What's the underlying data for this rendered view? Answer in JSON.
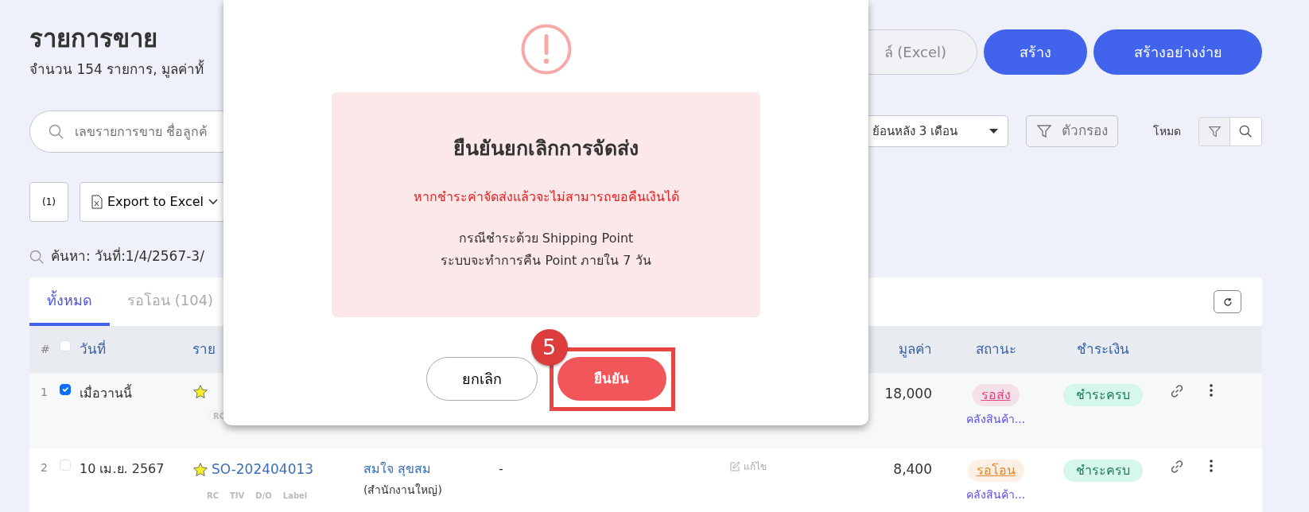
{
  "page": {
    "title": "รายการขาย",
    "subtitle": "จำนวน 154 รายการ, มูลค่าทั้"
  },
  "header_buttons": [
    {
      "label": "ล์ (Excel)",
      "kind": "outline"
    },
    {
      "label": "สร้าง",
      "kind": "primary"
    },
    {
      "label": "สร้างอย่างง่าย",
      "kind": "primary"
    }
  ],
  "search": {
    "placeholder": "เลขรายการขาย ชื่อลูกค้"
  },
  "period_select": {
    "value": "ย้อนหลัง 3 เดือน"
  },
  "filter_button": {
    "label": "ตัวกรอง"
  },
  "mode": {
    "label": "โหมด",
    "options": [
      {
        "kind": "filter",
        "selected": true
      },
      {
        "kind": "search",
        "selected": false
      }
    ]
  },
  "toolbar": {
    "count_button": "(1)",
    "export_button": "Export to Excel"
  },
  "search_summary": "ค้นหา: วันที่:1/4/2567-3/",
  "tabs": [
    {
      "label": "ทั้งหมด",
      "selected": true
    },
    {
      "label": "รอโอน (104)",
      "selected": false
    }
  ],
  "table": {
    "columns": {
      "index": "#",
      "date": "วันที่",
      "column_4": "ราย",
      "value": "มูลค่า",
      "status": "สถานะ",
      "payment": "ชำระเงิน"
    },
    "select_all": false,
    "rows": [
      {
        "index": "1",
        "checked": true,
        "date": "เมื่อวานนี้",
        "starred": true,
        "tags": [
          "RC"
        ],
        "value": "18,000",
        "status": {
          "label": "รอส่ง",
          "color": "#e0457b"
        },
        "warehouse": "คลังสินค้า...",
        "payment": "ชำระครบ"
      },
      {
        "index": "2",
        "checked": false,
        "date": "10 เม.ย. 2567",
        "starred": true,
        "order_no": "SO-202404013",
        "tags": [
          "RC",
          "TIV",
          "D/O",
          "Label"
        ],
        "customer": "สมใจ สุขสม",
        "branch": "(สำนักงานใหญ่)",
        "note": "-",
        "edit": "แก้ไข",
        "value": "8,400",
        "status": {
          "label": "รอโอน",
          "color": "#e8872a"
        },
        "warehouse": "คลังสินค้า...",
        "payment": "ชำระครบ"
      }
    ]
  },
  "dialog": {
    "title": "ยืนยันยกเลิกการจัดส่ง",
    "warning": "หากชำระค่าจัดส่งแล้วจะไม่สามารถขอคืนเงินได้",
    "notes": [
      "กรณีชำระด้วย Shipping Point",
      "ระบบจะทำการคืน Point ภายใน 7 วัน"
    ],
    "cancel": "ยกเลิก",
    "confirm": "ยืนยัน"
  },
  "annotation": {
    "step": "5"
  }
}
